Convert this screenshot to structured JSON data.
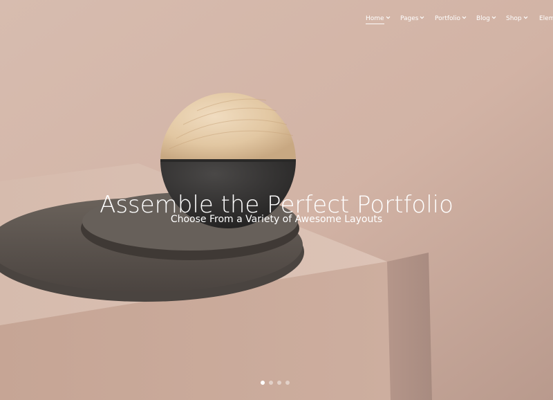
{
  "nav": {
    "items": [
      {
        "label": "Home",
        "active": true,
        "icon": "chevron-down-icon"
      },
      {
        "label": "Pages",
        "active": false,
        "icon": "chevron-down-icon"
      },
      {
        "label": "Portfolio",
        "active": false,
        "icon": "chevron-down-icon"
      },
      {
        "label": "Blog",
        "active": false,
        "icon": "chevron-down-icon"
      },
      {
        "label": "Shop",
        "active": false,
        "icon": "chevron-down-icon"
      },
      {
        "label": "Elem",
        "active": false,
        "icon": ""
      }
    ]
  },
  "hero": {
    "title": "Assemble the Perfect Portfolio",
    "subtitle": "Choose From a Variety of Awesome Layouts"
  },
  "slider": {
    "total_slides": 4,
    "active_slide": 1
  },
  "colors": {
    "wall": "#d3b6a8",
    "pedestal": "#c9aa9a",
    "disc": "#5a524c",
    "sphere_wood": "#e7cfae",
    "sphere_stone": "#2e2d2c",
    "text": "#ffffff"
  }
}
